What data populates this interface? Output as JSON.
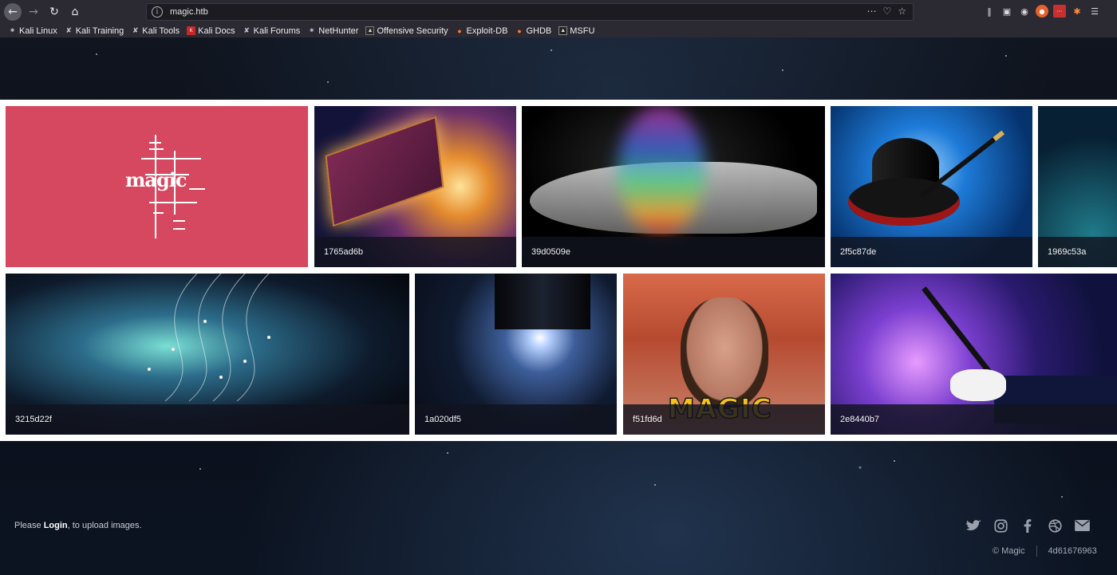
{
  "browser": {
    "url": "magic.htb",
    "bookmarks": [
      {
        "label": "Kali Linux",
        "icon": "kali-dragon-icon"
      },
      {
        "label": "Kali Training",
        "icon": "kali-dragon-icon"
      },
      {
        "label": "Kali Tools",
        "icon": "kali-dragon-icon"
      },
      {
        "label": "Kali Docs",
        "icon": "kali-docs-icon"
      },
      {
        "label": "Kali Forums",
        "icon": "kali-dragon-icon"
      },
      {
        "label": "NetHunter",
        "icon": "nethunter-icon"
      },
      {
        "label": "Offensive Security",
        "icon": "offsec-icon"
      },
      {
        "label": "Exploit-DB",
        "icon": "exploitdb-icon"
      },
      {
        "label": "GHDB",
        "icon": "ghdb-icon"
      },
      {
        "label": "MSFU",
        "icon": "msfu-icon"
      }
    ]
  },
  "gallery": {
    "logo_text": "magic",
    "tiles": [
      {
        "caption": ""
      },
      {
        "caption": "1765ad6b"
      },
      {
        "caption": "39d0509e"
      },
      {
        "caption": "2f5c87de"
      },
      {
        "caption": "1969c53a"
      },
      {
        "caption": "3215d22f"
      },
      {
        "caption": "1a020df5"
      },
      {
        "caption": "f51fd6d"
      },
      {
        "caption": "2e8440b7"
      }
    ],
    "gif_overlay_text": "MAGIC"
  },
  "footer": {
    "login_prefix": "Please ",
    "login_link": "Login",
    "login_suffix": ", to upload images.",
    "social_icons": [
      "twitter-icon",
      "instagram-icon",
      "facebook-icon",
      "dribbble-icon",
      "mail-icon"
    ],
    "copyright": "© Magic",
    "code": "4d61676963"
  }
}
